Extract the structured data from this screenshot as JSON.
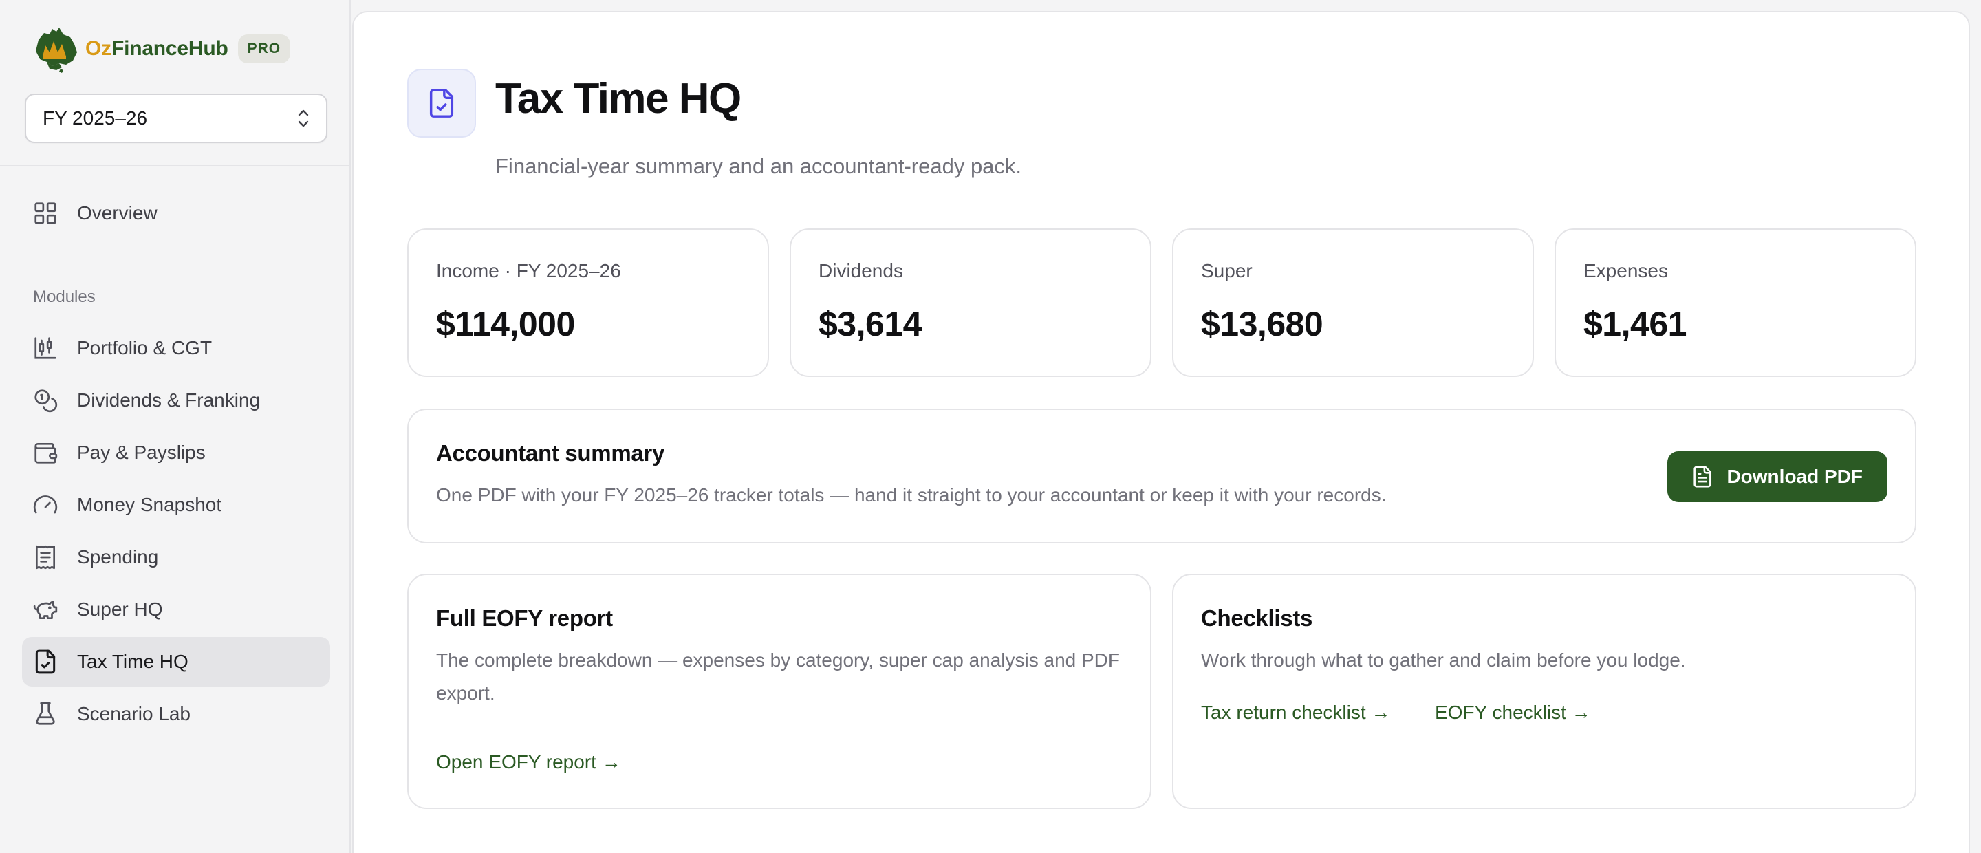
{
  "brand": {
    "name_part1": "Oz",
    "name_part2": "FinanceHub",
    "badge": "PRO"
  },
  "fy_select": {
    "value": "FY 2025–26"
  },
  "nav": {
    "overview": "Overview",
    "modules_heading": "Modules",
    "items": [
      {
        "label": "Portfolio & CGT",
        "icon": "candlestick-chart-icon"
      },
      {
        "label": "Dividends & Franking",
        "icon": "coins-icon"
      },
      {
        "label": "Pay & Payslips",
        "icon": "wallet-icon"
      },
      {
        "label": "Money Snapshot",
        "icon": "gauge-icon"
      },
      {
        "label": "Spending",
        "icon": "receipt-icon"
      },
      {
        "label": "Super HQ",
        "icon": "piggy-bank-icon"
      },
      {
        "label": "Tax Time HQ",
        "icon": "file-check-icon",
        "active": true
      },
      {
        "label": "Scenario Lab",
        "icon": "flask-icon"
      }
    ]
  },
  "header": {
    "title": "Tax Time HQ",
    "subtitle": "Financial-year summary and an accountant-ready pack."
  },
  "stats": [
    {
      "label": "Income · FY 2025–26",
      "value": "$114,000"
    },
    {
      "label": "Dividends",
      "value": "$3,614"
    },
    {
      "label": "Super",
      "value": "$13,680"
    },
    {
      "label": "Expenses",
      "value": "$1,461"
    }
  ],
  "accountant": {
    "title": "Accountant summary",
    "text": "One PDF with your FY 2025–26 tracker totals — hand it straight to your accountant or keep it with your records.",
    "button": "Download PDF"
  },
  "eofy": {
    "title": "Full EOFY report",
    "text": "The complete breakdown — expenses by category, super cap analysis and PDF export.",
    "link": "Open EOFY report →"
  },
  "checklists": {
    "title": "Checklists",
    "text": "Work through what to gather and claim before you lodge.",
    "link1": "Tax return checklist →",
    "link2": "EOFY checklist →"
  },
  "colors": {
    "accent_green": "#2b5a24",
    "brand_gold": "#d99a16",
    "page_icon_bg": "#eef0fb",
    "page_icon_stroke": "#4f46e5"
  }
}
